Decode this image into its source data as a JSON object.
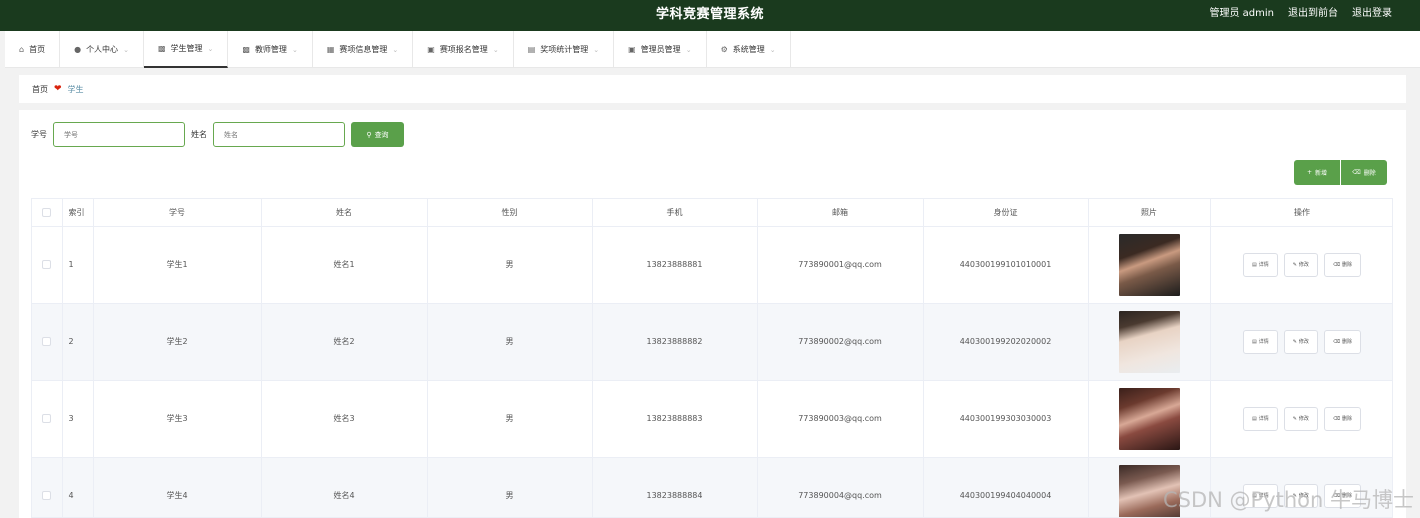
{
  "header": {
    "title": "学科竞赛管理系统",
    "user_label": "管理员 admin",
    "to_front": "退出到前台",
    "logout": "退出登录",
    "bg_color": "#1a3a1e"
  },
  "nav": {
    "items": [
      {
        "label": "首页",
        "icon": "home-icon"
      },
      {
        "label": "个人中心",
        "icon": "person-icon"
      },
      {
        "label": "学生管理",
        "icon": "student-icon"
      },
      {
        "label": "教师管理",
        "icon": "teacher-icon"
      },
      {
        "label": "赛项信息管理",
        "icon": "grid-icon"
      },
      {
        "label": "赛项报名管理",
        "icon": "clipboard-icon"
      },
      {
        "label": "奖项统计管理",
        "icon": "chart-icon"
      },
      {
        "label": "管理员管理",
        "icon": "clipboard-icon"
      },
      {
        "label": "系统管理",
        "icon": "gear-icon"
      }
    ]
  },
  "breadcrumb": {
    "home": "首页",
    "current": "学生"
  },
  "search": {
    "label_id": "学号",
    "placeholder_id": "学号",
    "label_name": "姓名",
    "placeholder_name": "姓名",
    "button": "查询"
  },
  "toolbar": {
    "add": "新增",
    "delete": "删除",
    "accent": "#5aa04a"
  },
  "table": {
    "headers": [
      "索引",
      "学号",
      "姓名",
      "性别",
      "手机",
      "邮箱",
      "身份证",
      "照片",
      "操作"
    ],
    "ops": {
      "detail": "详情",
      "edit": "修改",
      "delete": "删除"
    },
    "rows": [
      {
        "index": "1",
        "id": "学生1",
        "name": "姓名1",
        "gender": "男",
        "phone": "13823888881",
        "email": "773890001@qq.com",
        "idcard": "440300199101010001"
      },
      {
        "index": "2",
        "id": "学生2",
        "name": "姓名2",
        "gender": "男",
        "phone": "13823888882",
        "email": "773890002@qq.com",
        "idcard": "440300199202020002"
      },
      {
        "index": "3",
        "id": "学生3",
        "name": "姓名3",
        "gender": "男",
        "phone": "13823888883",
        "email": "773890003@qq.com",
        "idcard": "440300199303030003"
      },
      {
        "index": "4",
        "id": "学生4",
        "name": "姓名4",
        "gender": "男",
        "phone": "13823888884",
        "email": "773890004@qq.com",
        "idcard": "440300199404040004"
      }
    ]
  },
  "watermark": "CSDN @Python 牛马博士"
}
